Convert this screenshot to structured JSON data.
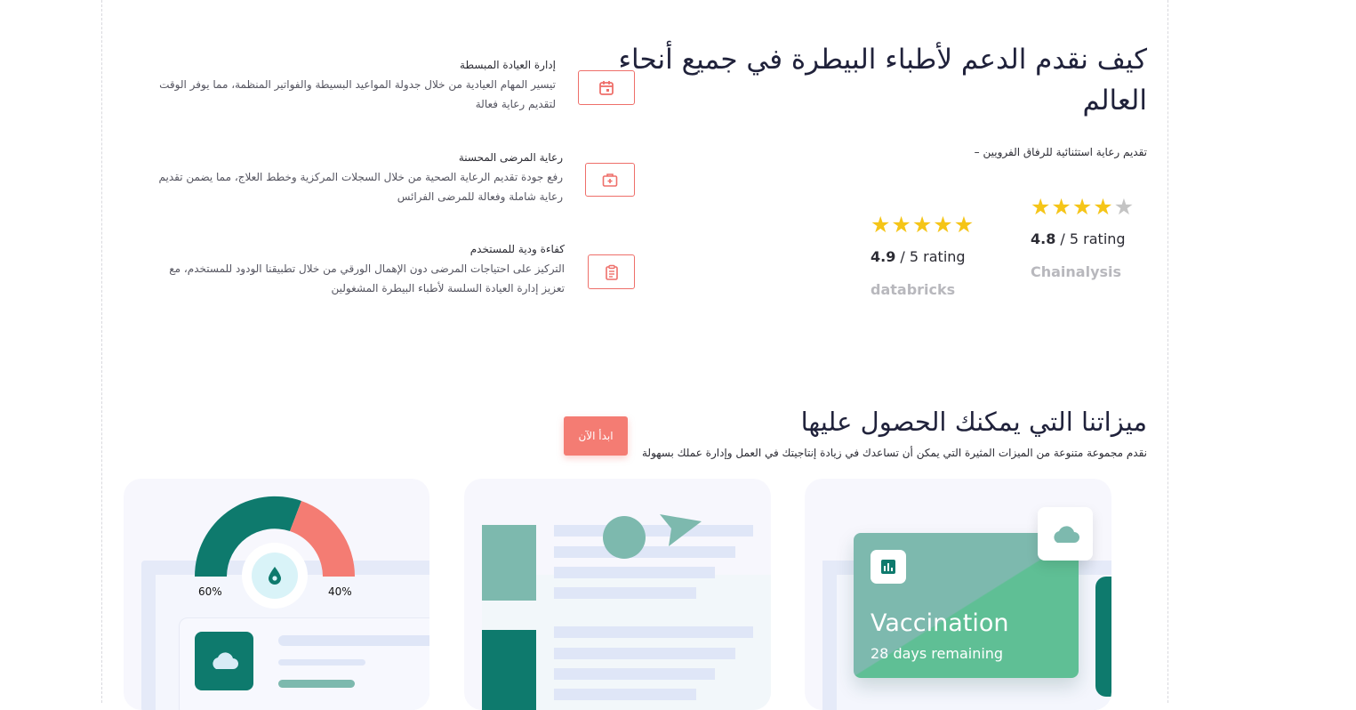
{
  "hero": {
    "title_line1": "كيف نقدم الدعم لأطباء البيطرة في جميع أنحاء",
    "title_line2": "العالم",
    "subtitle": "تقديم رعاية استثنائية للرفاق الفرويين –"
  },
  "ratings": [
    {
      "stars": 4,
      "score": "4.8",
      "suffix": " / 5 rating",
      "brand": "Chainalysis"
    },
    {
      "stars": 5,
      "score": "4.9",
      "suffix": " / 5 rating",
      "brand": "databricks"
    }
  ],
  "colors": {
    "star_filled": "#f5c518",
    "star_empty": "#c4c4c4",
    "accent": "#f47c73",
    "teal": "#0e7a6d"
  },
  "features": [
    {
      "title": "إدارة العيادة المبسطة",
      "desc1": "تيسير المهام العيادية من خلال جدولة المواعيد البسيطة والفواتير المنظمة، مما يوفر الوقت",
      "desc2": "لتقديم رعاية فعالة",
      "icon": "calendar-icon"
    },
    {
      "title": "رعاية المرضى المحسنة",
      "desc1": "رفع جودة تقديم الرعاية الصحية من خلال السجلات المركزية وخطط العلاج، مما يضمن تقديم",
      "desc2": "رعاية شاملة وفعالة للمرضى الفرائس",
      "icon": "first-aid-kit-icon"
    },
    {
      "title": "كفاءة ودية للمستخدم",
      "desc1": "التركيز على احتياجات المرضى دون الإهمال الورقي من خلال تطبيقنا الودود للمستخدم، مع",
      "desc2": "تعزيز إدارة العيادة السلسة لأطباء البيطرة المشغولين",
      "icon": "clipboard-icon"
    }
  ],
  "section2": {
    "title": "ميزاتنا التي يمكنك الحصول عليها",
    "subtitle": "نقدم مجموعة متنوعة من الميزات المثيرة التي يمكن أن تساعدك في زيادة إنتاجيتك في العمل وإدارة عملك بسهولة",
    "cta": "ابدأ الآن"
  },
  "gauge": {
    "left_label": "60%",
    "right_label": "40%",
    "left_value": 60,
    "right_value": 40
  },
  "vaccination": {
    "title": "Vaccination",
    "subtitle": "28 days remaining"
  }
}
